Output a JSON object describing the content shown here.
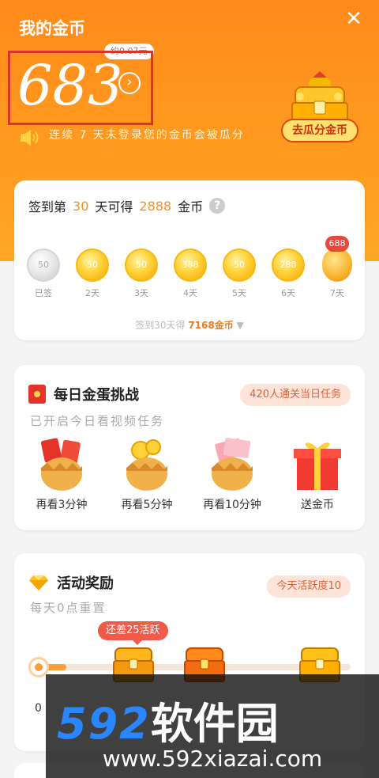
{
  "header": {
    "title": "我的金币",
    "coin_balance": "683",
    "approx_value": "约0.07元",
    "detail_arrow": "›",
    "close_glyph": "✕",
    "warning_text": "连续 7 天未登录您的金币会被瓜分",
    "guafen_button": "去瓜分金币"
  },
  "signin": {
    "prefix": "签到第",
    "day_count": "30",
    "middle": "天可得",
    "reward": "2888",
    "suffix": "金币",
    "help": "?",
    "days": [
      {
        "value": "50",
        "label": "已签",
        "state": "done"
      },
      {
        "value": "50",
        "label": "2天",
        "state": "pending"
      },
      {
        "value": "50",
        "label": "3天",
        "state": "pending"
      },
      {
        "value": "388",
        "label": "4天",
        "state": "pending"
      },
      {
        "value": "50",
        "label": "5天",
        "state": "pending"
      },
      {
        "value": "288",
        "label": "6天",
        "state": "pending"
      },
      {
        "value": "688",
        "label": "7天",
        "state": "special"
      }
    ],
    "summary_prefix": "签到30天得",
    "summary_value": "7168金币",
    "summary_arrow": "▼"
  },
  "challenge": {
    "title": "每日金蛋挑战",
    "badge": "420人通关当日任务",
    "subtitle": "已开启今日看视频任务",
    "tasks": [
      {
        "label": "再看3分钟",
        "icon": "egg-redpacket-icon"
      },
      {
        "label": "再看5分钟",
        "icon": "egg-coins-icon"
      },
      {
        "label": "再看10分钟",
        "icon": "egg-cash-icon"
      },
      {
        "label": "送金币",
        "icon": "gift-box-icon"
      }
    ]
  },
  "activity": {
    "title": "活动奖励",
    "badge": "今天活跃度10",
    "subtitle": "每天0点重置",
    "gap_bubble": "还差25活跃",
    "start_label": "0",
    "progress_fraction": 0.1
  },
  "watermark": {
    "brand_num": "592",
    "brand_cn": "软件园",
    "url": "www.592xiazai.com"
  },
  "colors": {
    "accent_orange": "#ff8a1a",
    "highlight": "#e87c1c",
    "red": "#e5332a"
  }
}
